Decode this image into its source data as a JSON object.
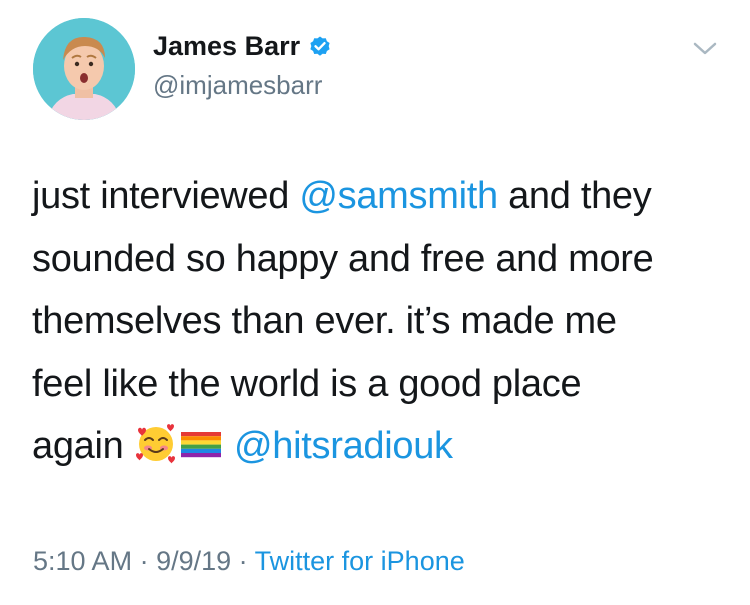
{
  "author": {
    "display_name": "James Barr",
    "handle": "@imjamesbarr",
    "verified": true,
    "avatar_icon": "profile-photo"
  },
  "tweet": {
    "text_line1_pre": "just interviewed ",
    "mention_1": "@samsmith",
    "text_line1_post": " and they",
    "text_line2": "sounded so happy and free and more",
    "text_line3": "themselves than ever. it’s made me",
    "text_line4": "feel like the world is a good place",
    "text_line5_pre": "again ",
    "emoji_1": "smiling-face-with-hearts",
    "emoji_2": "rainbow-flag",
    "mention_2": "@hitsradiouk"
  },
  "meta": {
    "time": "5:10 AM",
    "separator_1": " · ",
    "date": "9/9/19",
    "separator_2": " · ",
    "source": "Twitter for iPhone"
  },
  "colors": {
    "link": "#1b95e0",
    "secondary_text": "#657786",
    "primary_text": "#14171a",
    "avatar_bg": "#5cc6d3"
  }
}
